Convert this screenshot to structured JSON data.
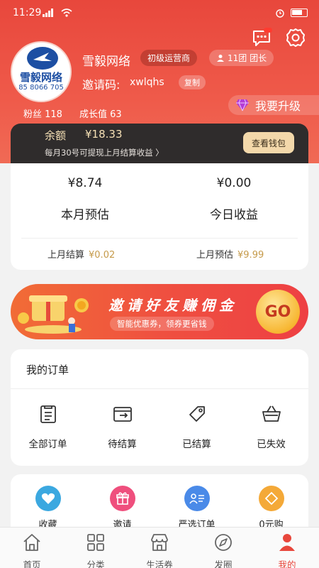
{
  "status_bar": {
    "time": "11:29"
  },
  "colors": {
    "brand": "#e8473c",
    "gold": "#c59a4a",
    "wallet_bg": "#2f2c2c"
  },
  "header": {
    "icons": [
      "message-icon",
      "settings-icon"
    ],
    "message_dots": "•••"
  },
  "profile": {
    "avatar_text": "雪毅网络",
    "avatar_number": "85 8066 705",
    "name": "雪毅网络",
    "level_badge": "初级运营商",
    "team_badge": "11团 团长",
    "invite_label": "邀请码:",
    "invite_code": "xwlqhs",
    "copy_label": "复制",
    "fans": "粉丝 118",
    "growth": "成长值 63",
    "upgrade_label": "我要升级"
  },
  "wallet": {
    "title": "余额",
    "amount": "¥18.33",
    "note": "每月30号可提现上月结算收益 〉",
    "button": "查看钱包"
  },
  "earnings": {
    "month_value": "¥8.74",
    "month_label": "本月预估",
    "today_value": "¥0.00",
    "today_label": "今日收益",
    "last_settle_label": "上月结算",
    "last_settle_value": "¥0.02",
    "last_estimate_label": "上月预估",
    "last_estimate_value": "¥9.99"
  },
  "banner": {
    "title": "邀请好友赚佣金",
    "subtitle": "智能优惠券，领券更省钱",
    "go_label": "GO"
  },
  "orders": {
    "title": "我的订单",
    "items": [
      {
        "label": "全部订单",
        "icon": "all-orders-icon"
      },
      {
        "label": "待结算",
        "icon": "pending-settle-icon"
      },
      {
        "label": "已结算",
        "icon": "settled-tag-icon"
      },
      {
        "label": "已失效",
        "icon": "invalid-basket-icon"
      }
    ]
  },
  "tools": {
    "items": [
      {
        "label": "收藏",
        "icon": "heart-icon",
        "color": "#3ba8e0"
      },
      {
        "label": "邀请",
        "icon": "gift-icon",
        "color": "#ef4f7d"
      },
      {
        "label": "严选订单",
        "icon": "user-list-icon",
        "color": "#4a8ae8"
      },
      {
        "label": "0元购",
        "icon": "diamond-icon",
        "color": "#f4a938"
      }
    ]
  },
  "tabbar": {
    "items": [
      {
        "label": "首页",
        "icon": "home-icon"
      },
      {
        "label": "分类",
        "icon": "grid-icon"
      },
      {
        "label": "生活券",
        "icon": "store-icon"
      },
      {
        "label": "发圈",
        "icon": "compass-icon"
      },
      {
        "label": "我的",
        "icon": "person-icon"
      }
    ]
  }
}
